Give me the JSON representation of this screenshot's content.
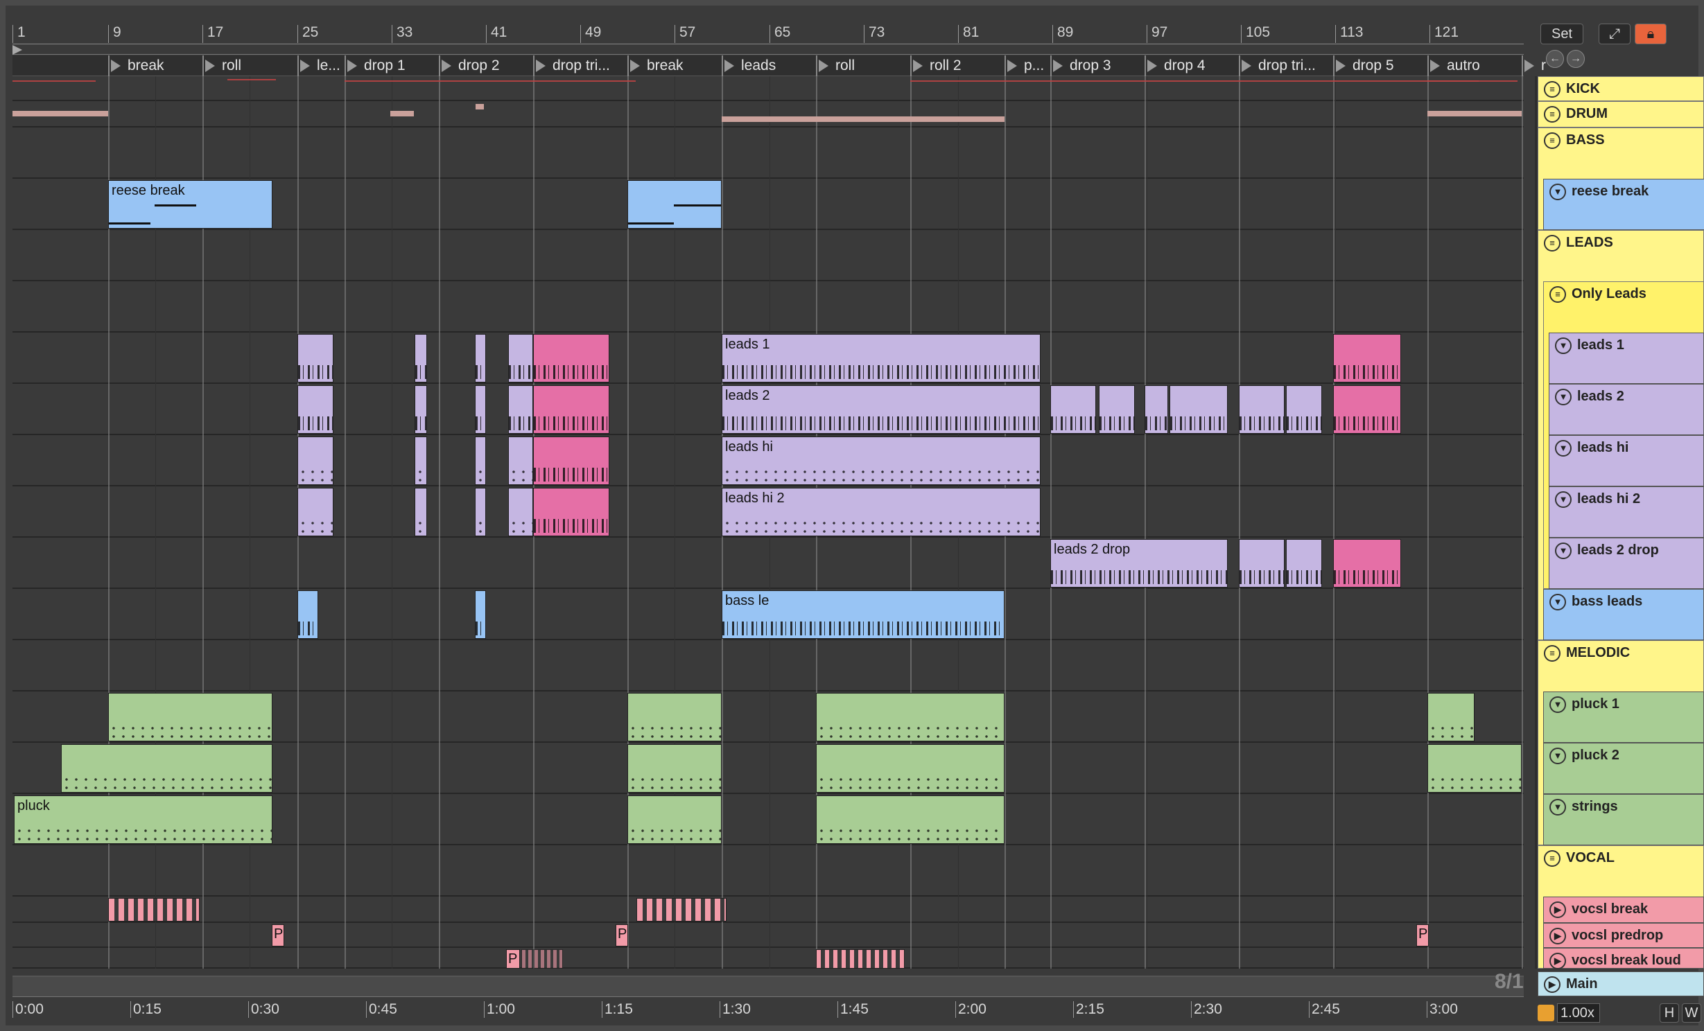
{
  "ruler": {
    "bars": [
      "1",
      "9",
      "17",
      "25",
      "33",
      "41",
      "49",
      "57",
      "65",
      "73",
      "81",
      "89",
      "97",
      "105",
      "113",
      "121"
    ]
  },
  "locators": [
    "break",
    "roll",
    "le...",
    "drop 1",
    "drop 2",
    "drop tri...",
    "break",
    "leads",
    "roll",
    "roll 2",
    "p...",
    "drop 3",
    "drop 4",
    "drop tri...",
    "drop 5",
    "autro",
    "r"
  ],
  "clips": {
    "reese": "reese break",
    "leads1": "leads 1",
    "leads2": "leads 2",
    "leadshi": "leads hi",
    "leadshi2": "leads hi 2",
    "leads2drop": "leads 2 drop",
    "bassleads": "bass le",
    "pluck": "pluck",
    "p1": "P",
    "p2": "P",
    "p3": "P",
    "p4": "P"
  },
  "timeline": [
    "0:00",
    "0:15",
    "0:30",
    "0:45",
    "1:00",
    "1:15",
    "1:30",
    "1:45",
    "2:00",
    "2:15",
    "2:30",
    "2:45",
    "3:00"
  ],
  "zoom_label": "8/1",
  "top": {
    "set": "Set"
  },
  "tracks": {
    "kick": "KICK",
    "drum": "DRUM",
    "bass": "BASS",
    "reese": "reese break",
    "leads": "LEADS",
    "onlyleads": "Only Leads",
    "l1": "leads 1",
    "l2": "leads 2",
    "lh": "leads hi",
    "lh2": "leads hi 2",
    "l2d": "leads 2 drop",
    "bl": "bass leads",
    "melodic": "MELODIC",
    "pluck1": "pluck 1",
    "pluck2": "pluck 2",
    "strings": "strings",
    "vocal": "VOCAL",
    "vb": "vocsl break",
    "vp": "vocsl predrop",
    "vbl": "vocsl break loud",
    "main": "Main"
  },
  "bottom": {
    "zoom": "1.00x",
    "h": "H",
    "w": "W"
  },
  "colors": {
    "group": "#fff58a",
    "lavender": "#c5b6e2",
    "blue": "#98c4f4",
    "green": "#a8cd94",
    "pink": "#e56fa6",
    "rose": "#f29ba8",
    "main": "#bfe3ee"
  }
}
